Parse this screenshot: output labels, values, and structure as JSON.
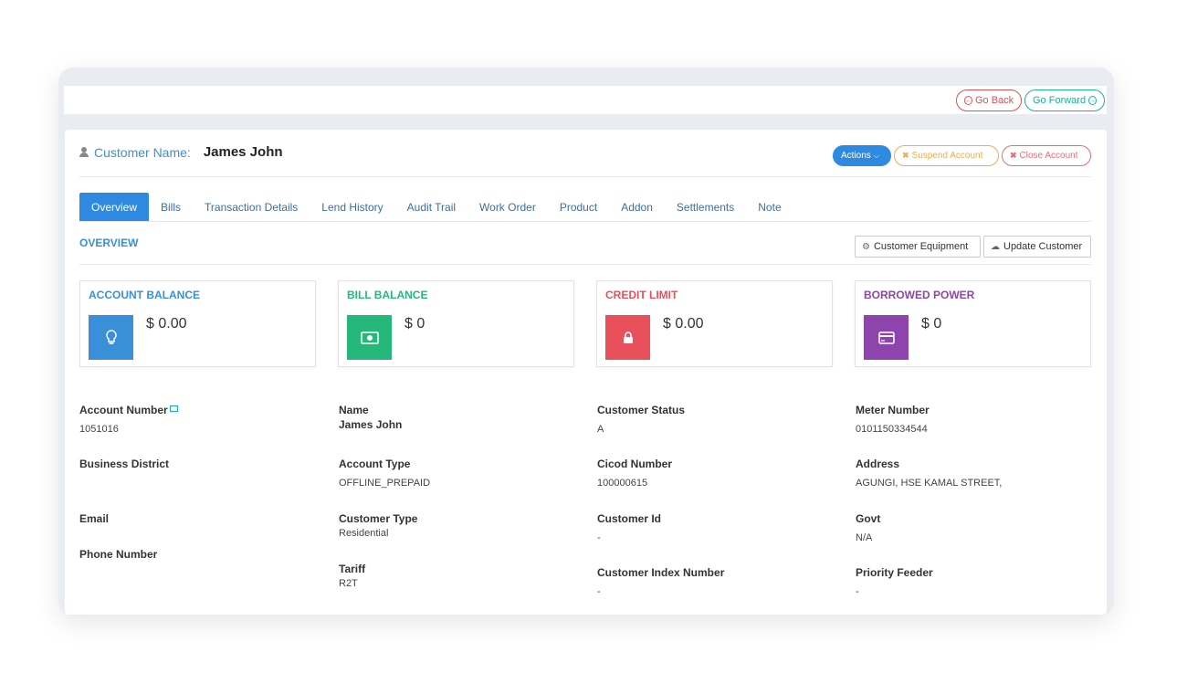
{
  "topbar": {
    "back_label": "Go Back",
    "forward_label": "Go Forward"
  },
  "header": {
    "customer_label": "Customer Name:",
    "customer_name": "James John",
    "actions_label": "Actions",
    "suspend_label": "Suspend Account",
    "close_label": "Close Account"
  },
  "tabs": [
    {
      "label": "Overview",
      "active": true
    },
    {
      "label": "Bills"
    },
    {
      "label": "Transaction Details"
    },
    {
      "label": "Lend History"
    },
    {
      "label": "Audit Trail"
    },
    {
      "label": "Work Order"
    },
    {
      "label": "Product"
    },
    {
      "label": "Addon"
    },
    {
      "label": "Settlements"
    },
    {
      "label": "Note"
    }
  ],
  "overview": {
    "title": "OVERVIEW",
    "equipment_label": "Customer Equipment",
    "update_label": "Update Customer"
  },
  "stats": [
    {
      "title": "ACCOUNT BALANCE",
      "value": "$ 0.00",
      "color": "#3a8fd9",
      "icon": "lightbulb-icon"
    },
    {
      "title": "BILL BALANCE",
      "value": "$ 0",
      "color": "#26b87a",
      "icon": "money-icon"
    },
    {
      "title": "CREDIT LIMIT",
      "value": "$ 0.00",
      "color": "#e8505b",
      "icon": "lock-icon"
    },
    {
      "title": "BORROWED POWER",
      "value": "$ 0",
      "color": "#8e44ad",
      "icon": "credit-card-icon"
    }
  ],
  "fields": {
    "account_number": {
      "label": "Account Number",
      "value": "1051016"
    },
    "business_district": {
      "label": "Business District",
      "value": ""
    },
    "email": {
      "label": "Email",
      "value": ""
    },
    "phone_number": {
      "label": "Phone Number",
      "value": ""
    },
    "name": {
      "label": "Name",
      "value": "James John"
    },
    "account_type": {
      "label": "Account Type",
      "value": "OFFLINE_PREPAID"
    },
    "customer_type": {
      "label": "Customer Type",
      "value": "Residential"
    },
    "tariff": {
      "label": "Tariff",
      "value": "R2T"
    },
    "customer_status": {
      "label": "Customer Status",
      "value": "A"
    },
    "cicod_number": {
      "label": "Cicod Number",
      "value": "100000615"
    },
    "customer_id": {
      "label": "Customer Id",
      "value": "-"
    },
    "customer_index_number": {
      "label": "Customer Index Number",
      "value": "-"
    },
    "meter_number": {
      "label": "Meter Number",
      "value": "0101150334544"
    },
    "address": {
      "label": "Address",
      "value": "AGUNGI, HSE KAMAL STREET,"
    },
    "govt": {
      "label": "Govt",
      "value": "N/A"
    },
    "priority_feeder": {
      "label": "Priority Feeder",
      "value": "-"
    }
  }
}
